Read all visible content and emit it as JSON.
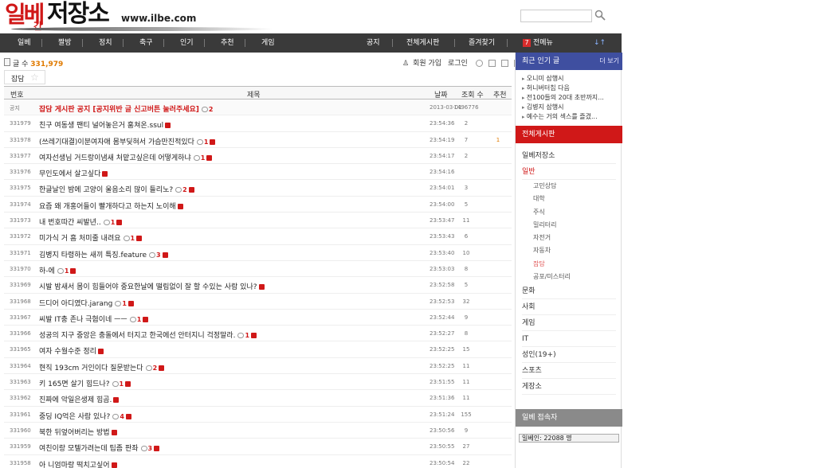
{
  "logo": {
    "part1": "일베",
    "part2": "간",
    "part3": "저장소",
    "url": "www.ilbe.com"
  },
  "search": {
    "placeholder": ""
  },
  "nav": {
    "left": [
      "일베",
      "짤방",
      "정치",
      "축구",
      "인기",
      "추천",
      "게임"
    ],
    "right": [
      "공지",
      "전체게시판",
      "즐겨찾기"
    ],
    "badge": "7",
    "menu": "전메뉴",
    "arrow": "↓↑"
  },
  "subheader": {
    "count_label": "글 수",
    "count": "331,979",
    "join": "회원 가입",
    "login": "로그인"
  },
  "board": {
    "name": "잡담"
  },
  "table": {
    "headers": {
      "no": "번호",
      "title": "제목",
      "date": "날짜",
      "views": "조회 수",
      "rec": "추천"
    },
    "rows": [
      {
        "no": "공지",
        "title": "잡담 게시판 공지 [공지위반 글 신고버튼 눌러주세요]",
        "cmt": "2",
        "new": false,
        "date": "2013-03-01",
        "views": "1496776",
        "rec": "",
        "notice": true
      },
      {
        "no": "331979",
        "title": "친구 여동생 팬티 널어놓은거 훔쳐온.ssul",
        "cmt": "",
        "new": true,
        "date": "23:54:36",
        "views": "2",
        "rec": ""
      },
      {
        "no": "331978",
        "title": "(쓰레기대결)이분여자애 몸부딪혀서 가슴만진적있다",
        "cmt": "1",
        "new": true,
        "date": "23:54:19",
        "views": "7",
        "rec": "1"
      },
      {
        "no": "331977",
        "title": "여자선생님 거드랑이냄새 처맡고싶은데 어떻게하냐",
        "cmt": "1",
        "new": true,
        "date": "23:54:17",
        "views": "2",
        "rec": ""
      },
      {
        "no": "331976",
        "title": "무인도에서 살고싶다",
        "cmt": "",
        "new": true,
        "date": "23:54:16",
        "views": "",
        "rec": ""
      },
      {
        "no": "331975",
        "title": "한글날인 밤에 고양이 울음소리 많이 들리노?",
        "cmt": "2",
        "new": true,
        "date": "23:54:01",
        "views": "3",
        "rec": ""
      },
      {
        "no": "331974",
        "title": "요즘 왜 개홍어들이 빨개하다고 하는지 노이해",
        "cmt": "",
        "new": true,
        "date": "23:54:00",
        "views": "5",
        "rec": ""
      },
      {
        "no": "331973",
        "title": "내 번호따간 씨발년..",
        "cmt": "1",
        "new": true,
        "date": "23:53:47",
        "views": "11",
        "rec": ""
      },
      {
        "no": "331972",
        "title": "미가식 거 흠 처미줄 내려요",
        "cmt": "1",
        "new": true,
        "date": "23:53:43",
        "views": "6",
        "rec": ""
      },
      {
        "no": "331971",
        "title": "김병지 타령하는 새끼 특징.feature",
        "cmt": "3",
        "new": true,
        "date": "23:53:40",
        "views": "10",
        "rec": ""
      },
      {
        "no": "331970",
        "title": "하-에",
        "cmt": "1",
        "new": true,
        "date": "23:53:03",
        "views": "8",
        "rec": ""
      },
      {
        "no": "331969",
        "title": "시발 밤새서 몸이 힘들어야 중요한날에 떨림없이 잘 할 수있는 사람 있나?",
        "cmt": "",
        "new": true,
        "date": "23:52:58",
        "views": "5",
        "rec": ""
      },
      {
        "no": "331968",
        "title": "드디어 아디였다.jarang",
        "cmt": "1",
        "new": true,
        "date": "23:52:53",
        "views": "32",
        "rec": ""
      },
      {
        "no": "331967",
        "title": "씨발 IT충 존나 극혐이네 ㅡㅡ",
        "cmt": "1",
        "new": true,
        "date": "23:52:44",
        "views": "9",
        "rec": ""
      },
      {
        "no": "331966",
        "title": "성공의 지구 중앙은 충돌에서 터지고 한국에선 안터지니 걱정말라.",
        "cmt": "1",
        "new": true,
        "date": "23:52:27",
        "views": "8",
        "rec": ""
      },
      {
        "no": "331965",
        "title": "여자 수월수준 정리",
        "cmt": "",
        "new": true,
        "date": "23:52:25",
        "views": "15",
        "rec": ""
      },
      {
        "no": "331964",
        "title": "현직 193cm 거인이다 질문받는다",
        "cmt": "2",
        "new": true,
        "date": "23:52:25",
        "views": "11",
        "rec": ""
      },
      {
        "no": "331963",
        "title": "키 165면 살기 힘드나?",
        "cmt": "1",
        "new": true,
        "date": "23:51:55",
        "views": "11",
        "rec": ""
      },
      {
        "no": "331962",
        "title": "진짜에 악일은생제 힘곰.",
        "cmt": "",
        "new": true,
        "date": "23:51:36",
        "views": "11",
        "rec": ""
      },
      {
        "no": "331961",
        "title": "중딩 IQ억은 사람 있나?",
        "cmt": "4",
        "new": true,
        "date": "23:51:24",
        "views": "155",
        "rec": ""
      },
      {
        "no": "331960",
        "title": "북한 뒤엎어버리는 방법",
        "cmt": "",
        "new": true,
        "date": "23:50:56",
        "views": "9",
        "rec": ""
      },
      {
        "no": "331959",
        "title": "여친이랑 모텔가려는데 팁좀 판좌",
        "cmt": "3",
        "new": true,
        "date": "23:50:55",
        "views": "27",
        "rec": ""
      },
      {
        "no": "331958",
        "title": "아 니엄마랑 떡치고싶어",
        "cmt": "",
        "new": true,
        "date": "23:50:54",
        "views": "22",
        "rec": ""
      }
    ]
  },
  "sidebar": {
    "popular_title": "최근 인기 글",
    "popular_more": "더 보기",
    "popular": [
      "오니미 삼행시",
      "허니버터칩 다음",
      "전100들의 20대 초반까지...",
      "김병지 삼행시",
      "예수는 거의 섹스를 즐겼..."
    ],
    "all_title": "전체게시판",
    "categories": [
      {
        "label": "일베저장소",
        "type": "cat"
      },
      {
        "label": "일반",
        "type": "cat",
        "active": true
      },
      {
        "label": "고민상담",
        "type": "sub"
      },
      {
        "label": "대학",
        "type": "sub"
      },
      {
        "label": "주식",
        "type": "sub"
      },
      {
        "label": "밀리터리",
        "type": "sub"
      },
      {
        "label": "자전거",
        "type": "sub"
      },
      {
        "label": "자동차",
        "type": "sub"
      },
      {
        "label": "잡담",
        "type": "sub",
        "active": true
      },
      {
        "label": "공포/미스터리",
        "type": "sub"
      },
      {
        "label": "문화",
        "type": "cat"
      },
      {
        "label": "사회",
        "type": "cat"
      },
      {
        "label": "게임",
        "type": "cat"
      },
      {
        "label": "IT",
        "type": "cat"
      },
      {
        "label": "성인(19+)",
        "type": "cat"
      },
      {
        "label": "스포츠",
        "type": "cat"
      },
      {
        "label": "게장소",
        "type": "cat"
      }
    ],
    "online_title": "일베 접속자",
    "online_text": "일베인: 22088 명"
  },
  "colors": {
    "brand_red": "#d01818",
    "nav_bg": "#3a3a3a",
    "sidebar_blue": "#3f4fa0",
    "count_orange": "#e07a00"
  }
}
